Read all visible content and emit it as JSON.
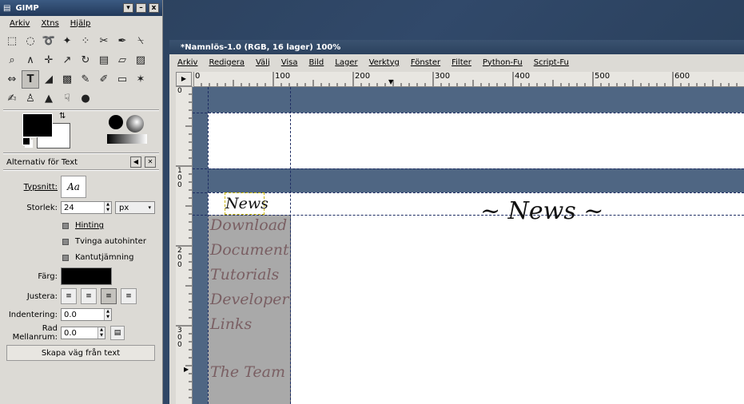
{
  "toolbox": {
    "title": "GIMP",
    "window_buttons": [
      "▾",
      "–",
      "x"
    ],
    "menu": [
      "Arkiv",
      "Xtns",
      "Hjälp"
    ],
    "tool_icons": [
      "rect-select-icon",
      "ellipse-select-icon",
      "lasso-icon",
      "magic-wand-icon",
      "color-select-icon",
      "scissors-icon",
      "paths-icon",
      "color-picker-icon",
      "zoom-icon",
      "measure-icon",
      "move-icon",
      "crop-icon",
      "rotate-icon",
      "scale-icon",
      "shear-icon",
      "perspective-icon",
      "flip-icon",
      "text-icon",
      "bucket-fill-icon",
      "blend-icon",
      "pencil-icon",
      "paintbrush-icon",
      "eraser-icon",
      "airbrush-icon",
      "ink-icon",
      "clone-icon",
      "blur-icon",
      "smudge-icon",
      "dodge-burn-icon"
    ],
    "tool_glyphs": [
      "⬚",
      "◌",
      "➰",
      "✦",
      "⁘",
      "✂",
      "✒",
      "⍀",
      "⌕",
      "∧",
      "✛",
      "↗",
      "↻",
      "▤",
      "▱",
      "▨",
      "⇔",
      "T",
      "◢",
      "▩",
      "✎",
      "✐",
      "▭",
      "✶",
      "✍",
      "♙",
      "▲",
      "☟",
      "●"
    ]
  },
  "options": {
    "title": "Alternativ för Text",
    "font_label": "Typsnitt:",
    "font_preview": "Aa",
    "size_label": "Storlek:",
    "size_value": "24",
    "unit_value": "px",
    "hinting_label": "Hinting",
    "autohint_label": "Tvinga autohinter",
    "antialias_label": "Kantutjämning",
    "color_label": "Färg:",
    "justify_label": "Justera:",
    "indent_label": "Indentering:",
    "indent_value": "0.0",
    "line_spacing_label_1": "Rad",
    "line_spacing_label_2": "Mellanrum:",
    "line_spacing_value": "0.0",
    "path_button": "Skapa väg från text"
  },
  "image_window": {
    "title": "*Namnlös-1.0 (RGB, 16 lager) 100%",
    "menu": [
      "Arkiv",
      "Redigera",
      "Välj",
      "Visa",
      "Bild",
      "Lager",
      "Verktyg",
      "Fönster",
      "Filter",
      "Python-Fu",
      "Script-Fu"
    ],
    "ruler_labels": [
      "0",
      "100",
      "200",
      "300",
      "400",
      "500",
      "600"
    ],
    "vruler_labels": [
      [
        "0"
      ],
      [
        "1",
        "0",
        "0"
      ],
      [
        "2",
        "0",
        "0"
      ],
      [
        "3",
        "0",
        "0"
      ]
    ]
  },
  "canvas": {
    "selected_text": "News",
    "heading": "~ News ~",
    "menu_items": [
      "Download",
      "Document",
      "Tutorials",
      "Developer",
      "Links",
      "The Team"
    ]
  }
}
